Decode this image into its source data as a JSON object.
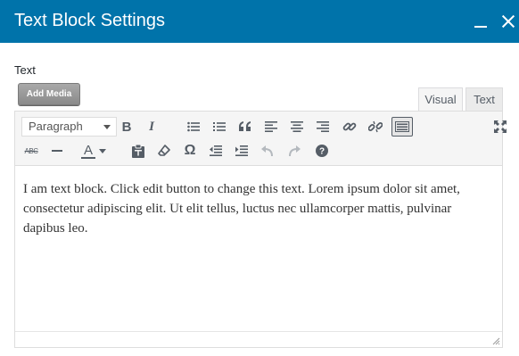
{
  "dialog": {
    "title": "Text Block Settings"
  },
  "field": {
    "label": "Text"
  },
  "buttons": {
    "add_media": "Add Media"
  },
  "tabs": {
    "visual": "Visual",
    "text": "Text"
  },
  "toolbar": {
    "format_select": "Paragraph",
    "row1_icons": [
      "bold-icon",
      "italic-icon",
      "bullet-list-icon",
      "numbered-list-icon",
      "blockquote-icon",
      "align-left-icon",
      "align-center-icon",
      "align-right-icon",
      "insert-link-icon",
      "remove-link-icon",
      "toolbar-toggle-icon",
      "fullscreen-icon"
    ],
    "row2_icons": [
      "strikethrough-icon",
      "horizontal-line-icon",
      "text-color-icon",
      "paste-as-text-icon",
      "clear-formatting-icon",
      "special-character-icon",
      "decrease-indent-icon",
      "increase-indent-icon",
      "undo-icon",
      "redo-icon",
      "help-icon"
    ],
    "bold_glyph": "B",
    "italic_glyph": "I",
    "text_color_glyph": "A",
    "strike_glyph": "ABC",
    "omega_glyph": "Ω"
  },
  "editor": {
    "content": "I am text block. Click edit button to change this text. Lorem ipsum dolor sit amet, consectetur adipiscing elit. Ut elit tellus, luctus nec ullamcorper mattis, pulvinar dapibus leo."
  },
  "colors": {
    "header_bg": "#0073aa",
    "text_color_swatch": "#555d66"
  }
}
